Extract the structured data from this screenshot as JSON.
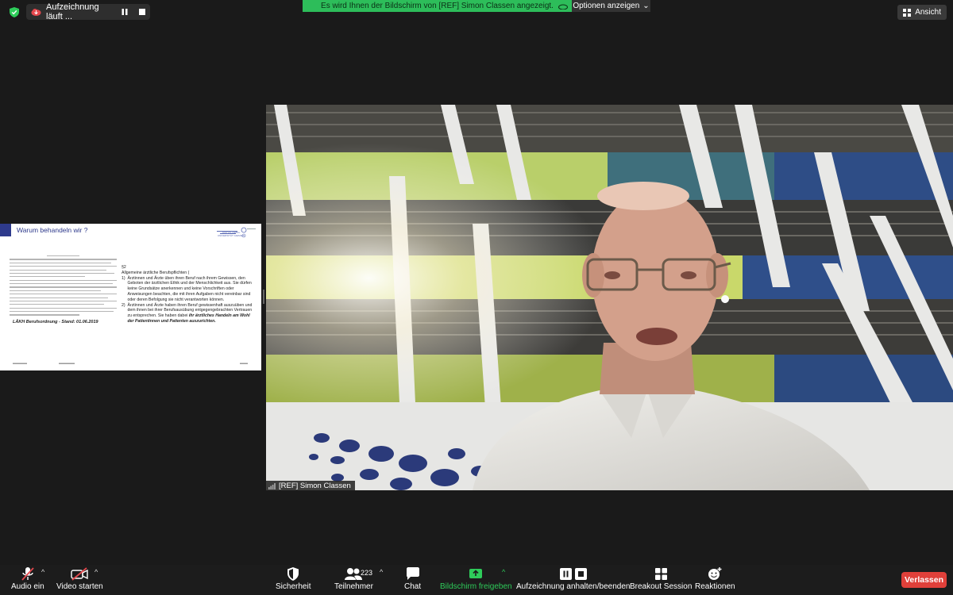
{
  "recording": {
    "label": "Aufzeichnung läuft ...",
    "pause_icon": "pause-icon",
    "stop_icon": "stop-icon"
  },
  "security_badge_icon": "shield-check-icon",
  "share_banner": {
    "text": "Es wird Ihnen der Bildschirm von [REF] Simon Classen angezeigt."
  },
  "options_button": {
    "label": "Optionen anzeigen"
  },
  "view_button": {
    "label": "Ansicht"
  },
  "slide": {
    "title": "Warum behandeln wir ?",
    "logo_text": "JUSTUS-LIEBIG-UNIVERSITÄT GIESSEN",
    "source": "LÄKH Berufsordnung - Stand: 01.06.2019",
    "section": "§2",
    "heading": "Allgemeine ärztliche Berufspflichten (",
    "items": [
      "Ärztinnen und Ärzte üben ihren Beruf nach ihrem Gewissen, den Geboten der ärztlichen Ethik und der Menschlichkeit aus. Sie dürfen keine Grundsätze anerkennen und keine Vorschriften oder Anweisungen beachten, die mit ihren Aufgaben nicht vereinbar sind oder deren Befolgung sie nicht verantworten können.",
      "Ärztinnen und Ärzte haben ihren Beruf gewissenhaft auszuüben und dem ihnen bei ihrer Berufsausübung entgegengebrachten Vertrauen zu entsprechen. Sie haben dabei"
    ],
    "emphasis": "ihr ärztliches Handeln am Wohl der Patientinnen und Patienten auszurichten."
  },
  "participant": {
    "name": "[REF] Simon Classen"
  },
  "toolbar": {
    "audio": "Audio ein",
    "video": "Video starten",
    "security": "Sicherheit",
    "participants": "Teilnehmer",
    "participants_count": "223",
    "chat": "Chat",
    "share": "Bildschirm freigeben",
    "recording": "Aufzeichnung anhalten/beenden",
    "breakout": "Breakout Session",
    "reactions": "Reaktionen",
    "leave": "Verlassen"
  },
  "colors": {
    "share_green": "#2dbd5a",
    "leave_red": "#e0403a",
    "slide_blue": "#2e3a8c"
  }
}
